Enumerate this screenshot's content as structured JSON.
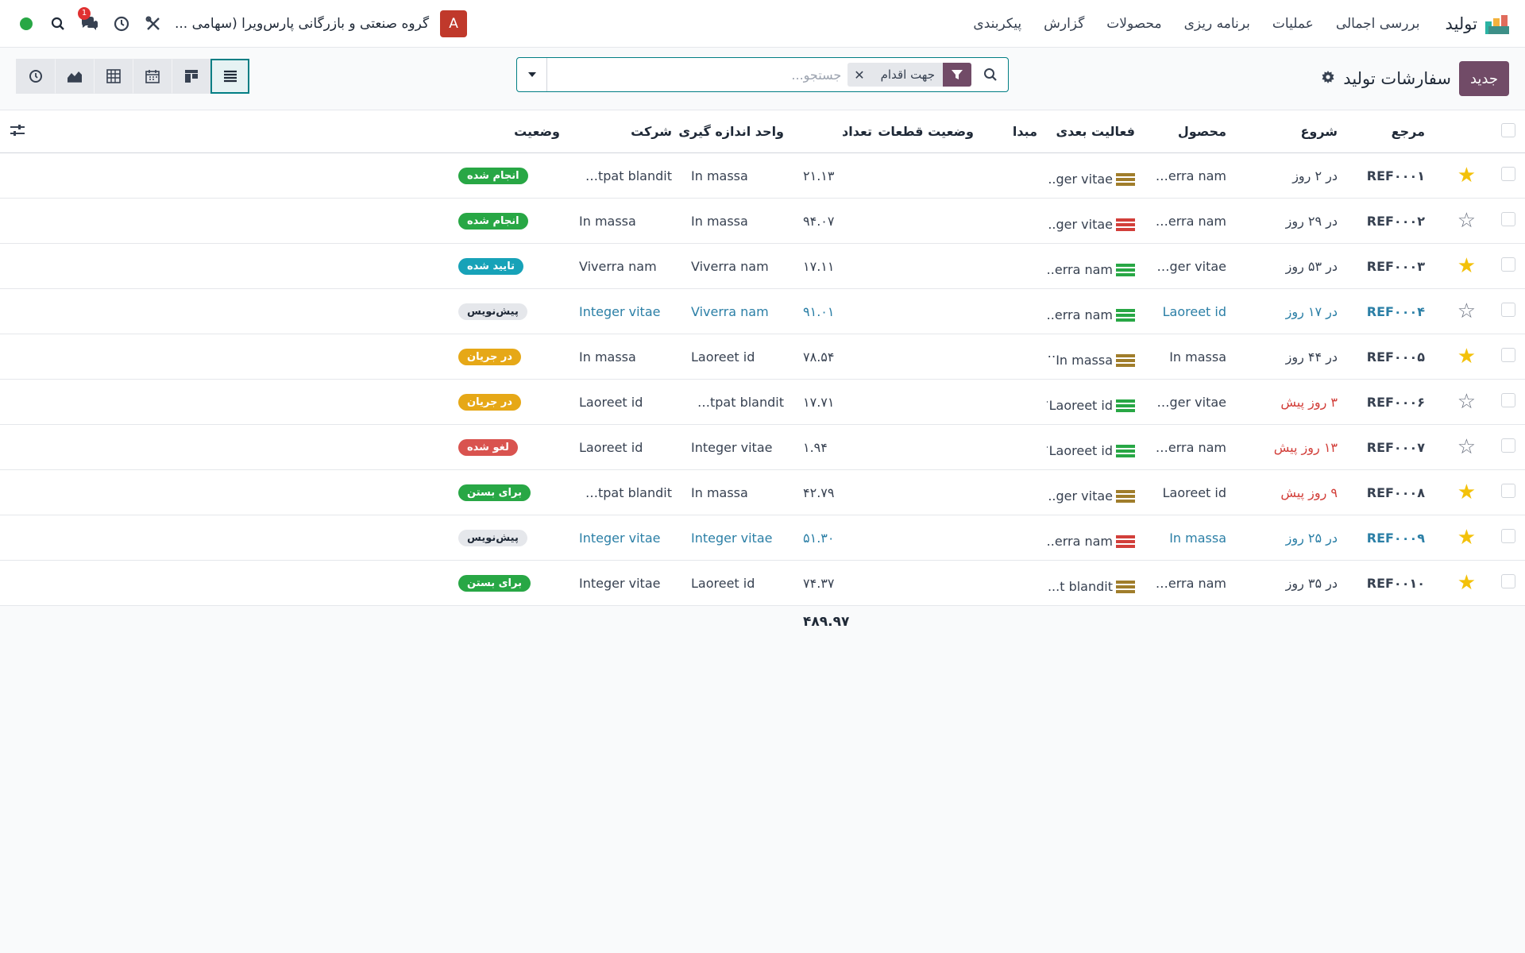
{
  "app": {
    "name": "تولید"
  },
  "menu": [
    "بررسی اجمالی",
    "عملیات",
    "برنامه ریزی",
    "محصولات",
    "گزارش",
    "پیکربندی"
  ],
  "topbar": {
    "company": "گروه صنعتی و بازرگانی پارس‌ویرا (سهامی ...",
    "avatar": "A",
    "chat_badge": "1",
    "status_color": "#28a745"
  },
  "control": {
    "new_label": "جدید",
    "page_title": "سفارشات تولید",
    "facet_label": "جهت اقدام",
    "search_placeholder": "جستجو..."
  },
  "columns": {
    "reference": "مرجع",
    "start": "شروع",
    "product": "محصول",
    "next_activity": "فعالیت بعدی",
    "source": "مبدا",
    "component_status": "وضعیت قطعات",
    "quantity": "تعداد",
    "uom": "واحد اندازه گیری",
    "company": "شرکت",
    "status": "وضعیت"
  },
  "rows": [
    {
      "ref": "REF۰۰۰۱",
      "fav": true,
      "start": "در ۲ روز",
      "start_style": "normal",
      "product": "Viverra nam",
      "activity": "...ger vitae",
      "act_color": "#a07d2b",
      "qty": "۲۱.۱۳",
      "uom": "In massa",
      "company": "Volutpat blandit",
      "status": "انجام شده",
      "status_color": "#28a745",
      "link": false
    },
    {
      "ref": "REF۰۰۰۲",
      "fav": false,
      "start": "در ۲۹ روز",
      "start_style": "normal",
      "product": "Viverra nam",
      "activity": "...ger vitae",
      "act_color": "#d23f3a",
      "qty": "۹۴.۰۷",
      "uom": "In massa",
      "company": "In massa",
      "status": "انجام شده",
      "status_color": "#28a745",
      "link": false
    },
    {
      "ref": "REF۰۰۰۳",
      "fav": true,
      "start": "در ۵۳ روز",
      "start_style": "normal",
      "product": "Integer vitae",
      "activity": "...erra nam",
      "act_color": "#28a745",
      "qty": "۱۷.۱۱",
      "uom": "Viverra nam",
      "company": "Viverra nam",
      "status": "تایید شده",
      "status_color": "#17a2b8",
      "link": false
    },
    {
      "ref": "REF۰۰۰۴",
      "fav": false,
      "start": "در ۱۷ روز",
      "start_style": "normal",
      "product": "Laoreet id",
      "activity": "...erra nam",
      "act_color": "#28a745",
      "qty": "۹۱.۰۱",
      "uom": "Viverra nam",
      "company": "Integer vitae",
      "status": "پیش‌نویس",
      "status_color": "#e5e7eb",
      "link": true
    },
    {
      "ref": "REF۰۰۰۵",
      "fav": true,
      "start": "در ۴۴ روز",
      "start_style": "normal",
      "product": "In massa",
      "activity": "In massa",
      "act_color": "#a07d2b",
      "qty": "۷۸.۵۴",
      "uom": "Laoreet id",
      "company": "In massa",
      "status": "در جریان",
      "status_color": "#e6a817",
      "link": false
    },
    {
      "ref": "REF۰۰۰۶",
      "fav": false,
      "start": "۳ روز پیش",
      "start_style": "late",
      "product": "Integer vitae",
      "activity": "Laoreet id",
      "act_color": "#28a745",
      "qty": "۱۷.۷۱",
      "uom": "Volutpat blandit",
      "company": "Laoreet id",
      "status": "در جریان",
      "status_color": "#e6a817",
      "link": false
    },
    {
      "ref": "REF۰۰۰۷",
      "fav": false,
      "start": "۱۳ روز پیش",
      "start_style": "late",
      "product": "Viverra nam",
      "activity": "Laoreet id",
      "act_color": "#28a745",
      "qty": "۱.۹۴",
      "uom": "Integer vitae",
      "company": "Laoreet id",
      "status": "لغو شده",
      "status_color": "#d9534f",
      "link": false
    },
    {
      "ref": "REF۰۰۰۸",
      "fav": true,
      "start": "۹ روز پیش",
      "start_style": "late",
      "product": "Laoreet id",
      "activity": "...ger vitae",
      "act_color": "#a07d2b",
      "qty": "۴۲.۷۹",
      "uom": "In massa",
      "company": "Volutpat blandit",
      "status": "برای بستن",
      "status_color": "#28a745",
      "link": false
    },
    {
      "ref": "REF۰۰۰۹",
      "fav": true,
      "start": "در ۲۵ روز",
      "start_style": "normal",
      "product": "In massa",
      "activity": "...erra nam",
      "act_color": "#d23f3a",
      "qty": "۵۱.۳۰",
      "uom": "Integer vitae",
      "company": "Integer vitae",
      "status": "پیش‌نویس",
      "status_color": "#e5e7eb",
      "link": true
    },
    {
      "ref": "REF۰۰۱۰",
      "fav": true,
      "start": "در ۳۵ روز",
      "start_style": "normal",
      "product": "Viverra nam",
      "activity": "...t blandit",
      "act_color": "#a07d2b",
      "qty": "۷۴.۳۷",
      "uom": "Laoreet id",
      "company": "Integer vitae",
      "status": "برای بستن",
      "status_color": "#28a745",
      "link": false
    }
  ],
  "total": "۴۸۹.۹۷"
}
